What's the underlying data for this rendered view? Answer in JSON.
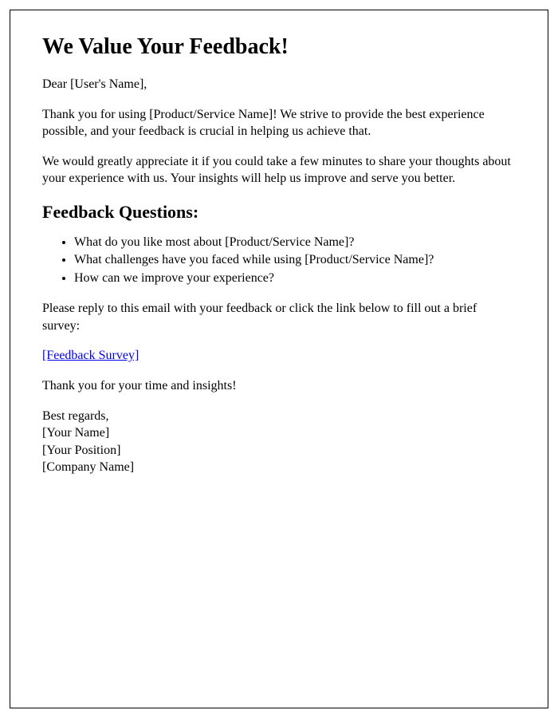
{
  "title": "We Value Your Feedback!",
  "greeting": "Dear [User's Name],",
  "intro1": "Thank you for using [Product/Service Name]! We strive to provide the best experience possible, and your feedback is crucial in helping us achieve that.",
  "intro2": "We would greatly appreciate it if you could take a few minutes to share your thoughts about your experience with us. Your insights will help us improve and serve you better.",
  "questionsHeading": "Feedback Questions:",
  "questions": [
    "What do you like most about [Product/Service Name]?",
    "What challenges have you faced while using [Product/Service Name]?",
    "How can we improve your experience?"
  ],
  "replyPrompt": "Please reply to this email with your feedback or click the link below to fill out a brief survey:",
  "surveyLinkText": "[Feedback Survey]",
  "thanks": "Thank you for your time and insights!",
  "signoff": {
    "regards": "Best regards,",
    "name": "[Your Name]",
    "position": "[Your Position]",
    "company": "[Company Name]"
  }
}
